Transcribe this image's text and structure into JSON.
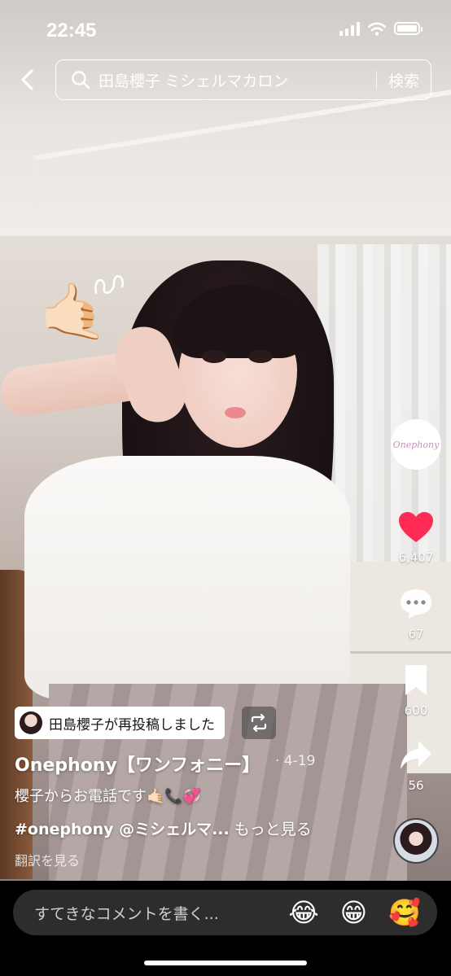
{
  "status_bar": {
    "time": "22:45"
  },
  "search": {
    "query": "田島櫻子 ミシェルマカロン",
    "button_label": "検索"
  },
  "creator_avatar": {
    "logo_text": "Onephony"
  },
  "actions": {
    "likes": "6,407",
    "comments": "67",
    "saves": "600",
    "shares": "56"
  },
  "repost": {
    "label": "田島櫻子が再投稿しました"
  },
  "post": {
    "author": "Onephony【ワンフォニー】",
    "date": "· 4-19",
    "caption": "櫻子からお電話です🤙🏻📞💞",
    "hashtags": "#onephony @ミシェルマ...",
    "more": "もっと見る",
    "translate": "翻訳を見る"
  },
  "comment_bar": {
    "placeholder": "すてきなコメントを書く...",
    "emojis": [
      "😂",
      "😁",
      "🥰"
    ]
  },
  "colors": {
    "like_red": "#fe2c55",
    "comment_box_bg": "#2d2d2d"
  }
}
